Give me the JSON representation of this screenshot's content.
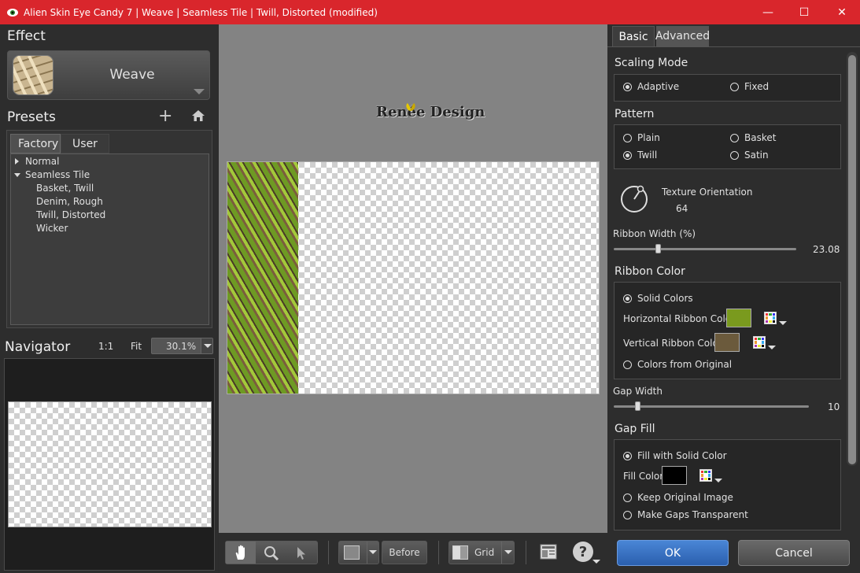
{
  "window": {
    "title": "Alien Skin Eye Candy 7 | Weave | Seamless Tile | Twill, Distorted (modified)"
  },
  "effect": {
    "header": "Effect",
    "name": "Weave"
  },
  "presets": {
    "header": "Presets",
    "tabs": [
      "Factory",
      "User"
    ],
    "tree": [
      {
        "label": "Normal",
        "level": 0,
        "expanded": false
      },
      {
        "label": "Seamless Tile",
        "level": 0,
        "expanded": true
      },
      {
        "label": "Basket, Twill",
        "level": 1
      },
      {
        "label": "Denim, Rough",
        "level": 1
      },
      {
        "label": "Twill, Distorted",
        "level": 1
      },
      {
        "label": "Wicker",
        "level": 1
      }
    ]
  },
  "navigator": {
    "header": "Navigator",
    "one_to_one": "1:1",
    "fit": "Fit",
    "zoom": "30.1%"
  },
  "canvas": {
    "watermark": "Renée Design"
  },
  "toolbar": {
    "before": "Before",
    "grid": "Grid",
    "help": "?"
  },
  "settings": {
    "tabs": [
      "Basic",
      "Advanced"
    ],
    "scaling_mode": {
      "title": "Scaling Mode",
      "options": [
        "Adaptive",
        "Fixed"
      ],
      "selected": "Adaptive"
    },
    "pattern": {
      "title": "Pattern",
      "options": [
        "Plain",
        "Basket",
        "Twill",
        "Satin"
      ],
      "selected": "Twill"
    },
    "texture_orientation": {
      "label": "Texture Orientation",
      "value": "64"
    },
    "ribbon_width": {
      "label": "Ribbon Width (%)",
      "value": "23.08",
      "fraction": 0.24
    },
    "ribbon_color": {
      "title": "Ribbon Color",
      "solid": "Solid Colors",
      "horizontal_label": "Horizontal Ribbon Color",
      "horizontal_color": "#7a9a1e",
      "vertical_label": "Vertical Ribbon Color",
      "vertical_color": "#6b5a3c",
      "original": "Colors from Original"
    },
    "gap_width": {
      "label": "Gap Width",
      "value": "10",
      "fraction": 0.12
    },
    "gap_fill": {
      "title": "Gap Fill",
      "solid": "Fill with Solid Color",
      "fill_label": "Fill Color",
      "fill_color": "#000000",
      "keep": "Keep Original Image",
      "transparent": "Make Gaps Transparent"
    }
  },
  "actions": {
    "ok": "OK",
    "cancel": "Cancel"
  },
  "colors": {
    "title_bar": "#d9262c",
    "ok_button": "#3a74c6"
  }
}
